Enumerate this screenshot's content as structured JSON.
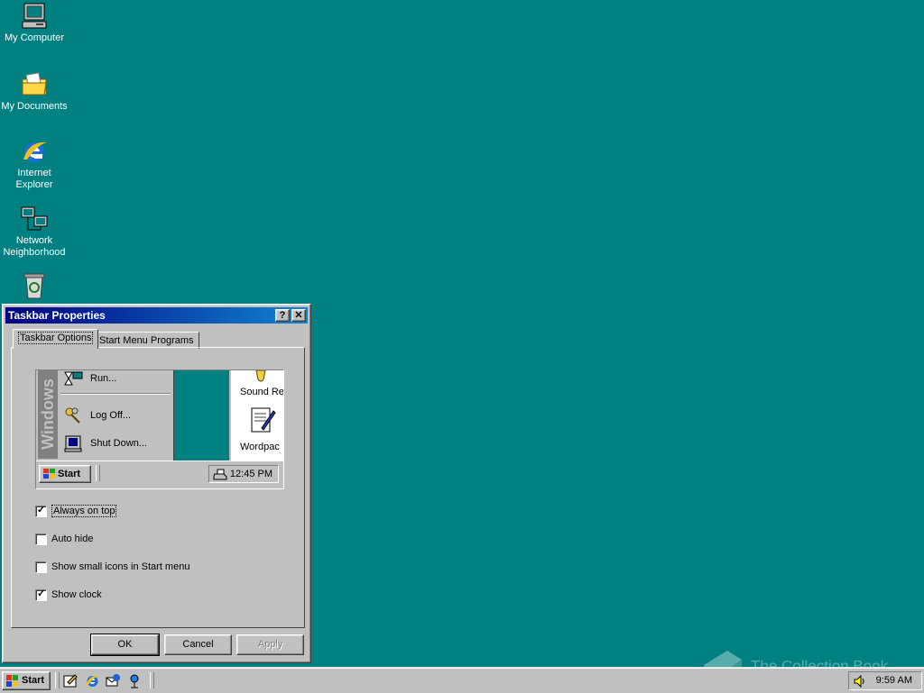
{
  "desktop": {
    "icons": [
      {
        "label": "My Computer"
      },
      {
        "label": "My Documents"
      },
      {
        "label": "Internet Explorer"
      },
      {
        "label": "Network Neighborhood"
      },
      {
        "label": ""
      }
    ]
  },
  "dialog": {
    "title": "Taskbar Properties",
    "help_glyph": "?",
    "close_glyph": "✕",
    "tabs": [
      {
        "label": "Taskbar Options",
        "active": true
      },
      {
        "label": "Start Menu Programs",
        "active": false
      }
    ],
    "preview": {
      "band_text": "Windows",
      "menu_items": [
        {
          "label": "Run...",
          "icon": "run-icon"
        },
        {
          "label": "Log Off...",
          "icon": "keys-icon"
        },
        {
          "label": "Shut Down...",
          "icon": "shutdown-icon"
        }
      ],
      "window_items": [
        "Sound Re",
        "Wordpac"
      ],
      "start_label": "Start",
      "clock": "12:45 PM"
    },
    "options": [
      {
        "label": "Always on top",
        "checked": true
      },
      {
        "label": "Auto hide",
        "checked": false
      },
      {
        "label": "Show small icons in Start menu",
        "checked": false
      },
      {
        "label": "Show clock",
        "checked": true
      }
    ],
    "buttons": {
      "ok": "OK",
      "cancel": "Cancel",
      "apply": "Apply"
    }
  },
  "taskbar": {
    "start_label": "Start",
    "quick_launch": [
      "show-desktop-icon",
      "internet-explorer-icon",
      "outlook-express-icon",
      "channels-icon"
    ],
    "clock": "9:59 AM"
  },
  "watermark": "The Collection Book",
  "colors": {
    "desktop": "#008080",
    "face": "#c0c0c0",
    "title_start": "#000080",
    "title_end": "#1084d0"
  }
}
